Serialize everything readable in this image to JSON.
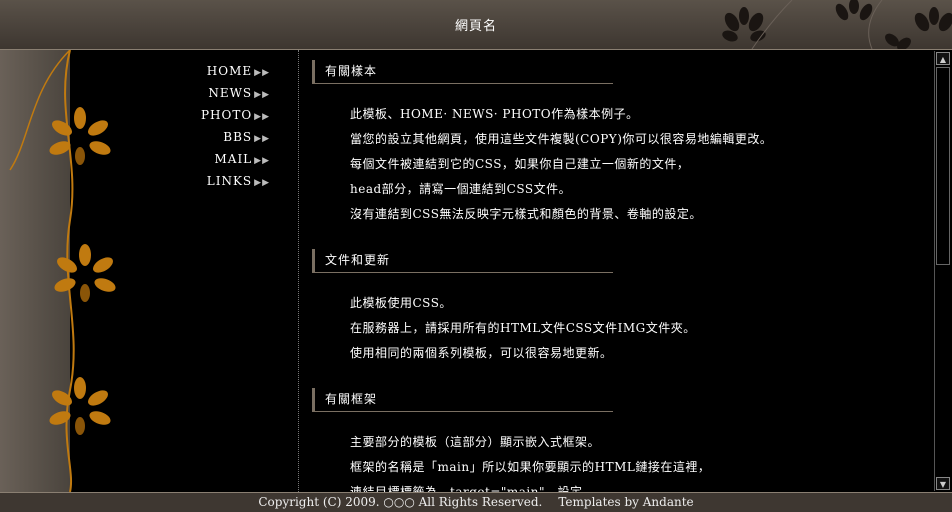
{
  "header": {
    "title": "網頁名"
  },
  "nav": [
    {
      "label": "HOME"
    },
    {
      "label": "NEWS"
    },
    {
      "label": "PHOTO"
    },
    {
      "label": "BBS"
    },
    {
      "label": "MAIL"
    },
    {
      "label": "LINKS"
    }
  ],
  "nav_arrow": "▶▶",
  "sections": [
    {
      "title": "有關樣本",
      "lines": [
        "此模板、HOME· NEWS· PHOTO作為樣本例子。",
        "當您的設立其他網頁，使用這些文件複製(COPY)你可以很容易地編輯更改。",
        "每個文件被連結到它的CSS，如果你自己建立一個新的文件，",
        "head部分，請寫一個連結到CSS文件。",
        "沒有連結到CSS無法反映字元樣式和顏色的背景、卷軸的設定。"
      ]
    },
    {
      "title": "文件和更新",
      "lines": [
        "此模板使用CSS。",
        "在服務器上，請採用所有的HTML文件CSS文件IMG文件夾。",
        "使用相同的兩個系列模板，可以很容易地更新。"
      ]
    },
    {
      "title": "有關框架",
      "lines": [
        "主要部分的模板（這部分）顯示嵌入式框架。",
        "框架的名稱是「main」所以如果你要顯示的HTML鏈接在這裡，",
        "連結目標標籤為　target=\"main\"　設定。"
      ]
    }
  ],
  "footer": {
    "copyright": "Copyright (C) 2009. ○○○ All Rights Reserved.",
    "credit": "Templates by Andante"
  },
  "colors": {
    "accent": "#c07a10",
    "header_bg": "#4a433b",
    "footer_bg": "#3e3731"
  }
}
